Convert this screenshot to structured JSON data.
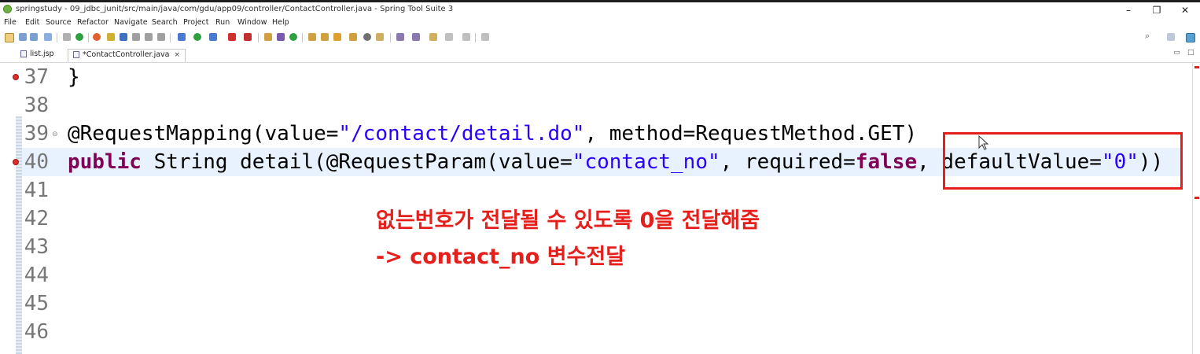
{
  "window": {
    "title": "springstudy - 09_jdbc_junit/src/main/java/com/gdu/app09/controller/ContactController.java - Spring Tool Suite 3",
    "controls": {
      "minimize": "–",
      "maximize": "❐",
      "close": "✕"
    }
  },
  "menu": [
    "File",
    "Edit",
    "Source",
    "Refactor",
    "Navigate",
    "Search",
    "Project",
    "Run",
    "Window",
    "Help"
  ],
  "tabs": [
    {
      "label": "list.jsp",
      "active": false
    },
    {
      "label": "*ContactController.java",
      "active": true,
      "close": "×"
    }
  ],
  "code_lines": [
    {
      "num": "37",
      "text": "}"
    },
    {
      "num": "38",
      "text": ""
    },
    {
      "num": "39",
      "pre": "@RequestMapping(value=",
      "s1": "\"/contact/detail.do\"",
      "post": ", method=RequestMethod.GET)"
    },
    {
      "num": "40",
      "kw1": "public",
      "mid": " String detail(@RequestParam(value=",
      "s1": "\"contact_no\"",
      "mid2": ", required=",
      "kw2": "false",
      "mid3": ", defaultValue=",
      "s2": "\"0\"",
      "end": "))"
    },
    {
      "num": "41",
      "text": ""
    },
    {
      "num": "42",
      "text": ""
    },
    {
      "num": "43",
      "text": ""
    },
    {
      "num": "44",
      "text": ""
    },
    {
      "num": "45",
      "text": ""
    },
    {
      "num": "46",
      "text": ""
    }
  ],
  "annotations": {
    "line1": "없는번호가 전달될 수 있도록 0을 전달해줌",
    "line2": "-> contact_no 변수전달"
  },
  "colors": {
    "keyword": "#7f0055",
    "string": "#2a00ff",
    "annotation": "#e5201c",
    "current_line": "#e8f2fe"
  }
}
